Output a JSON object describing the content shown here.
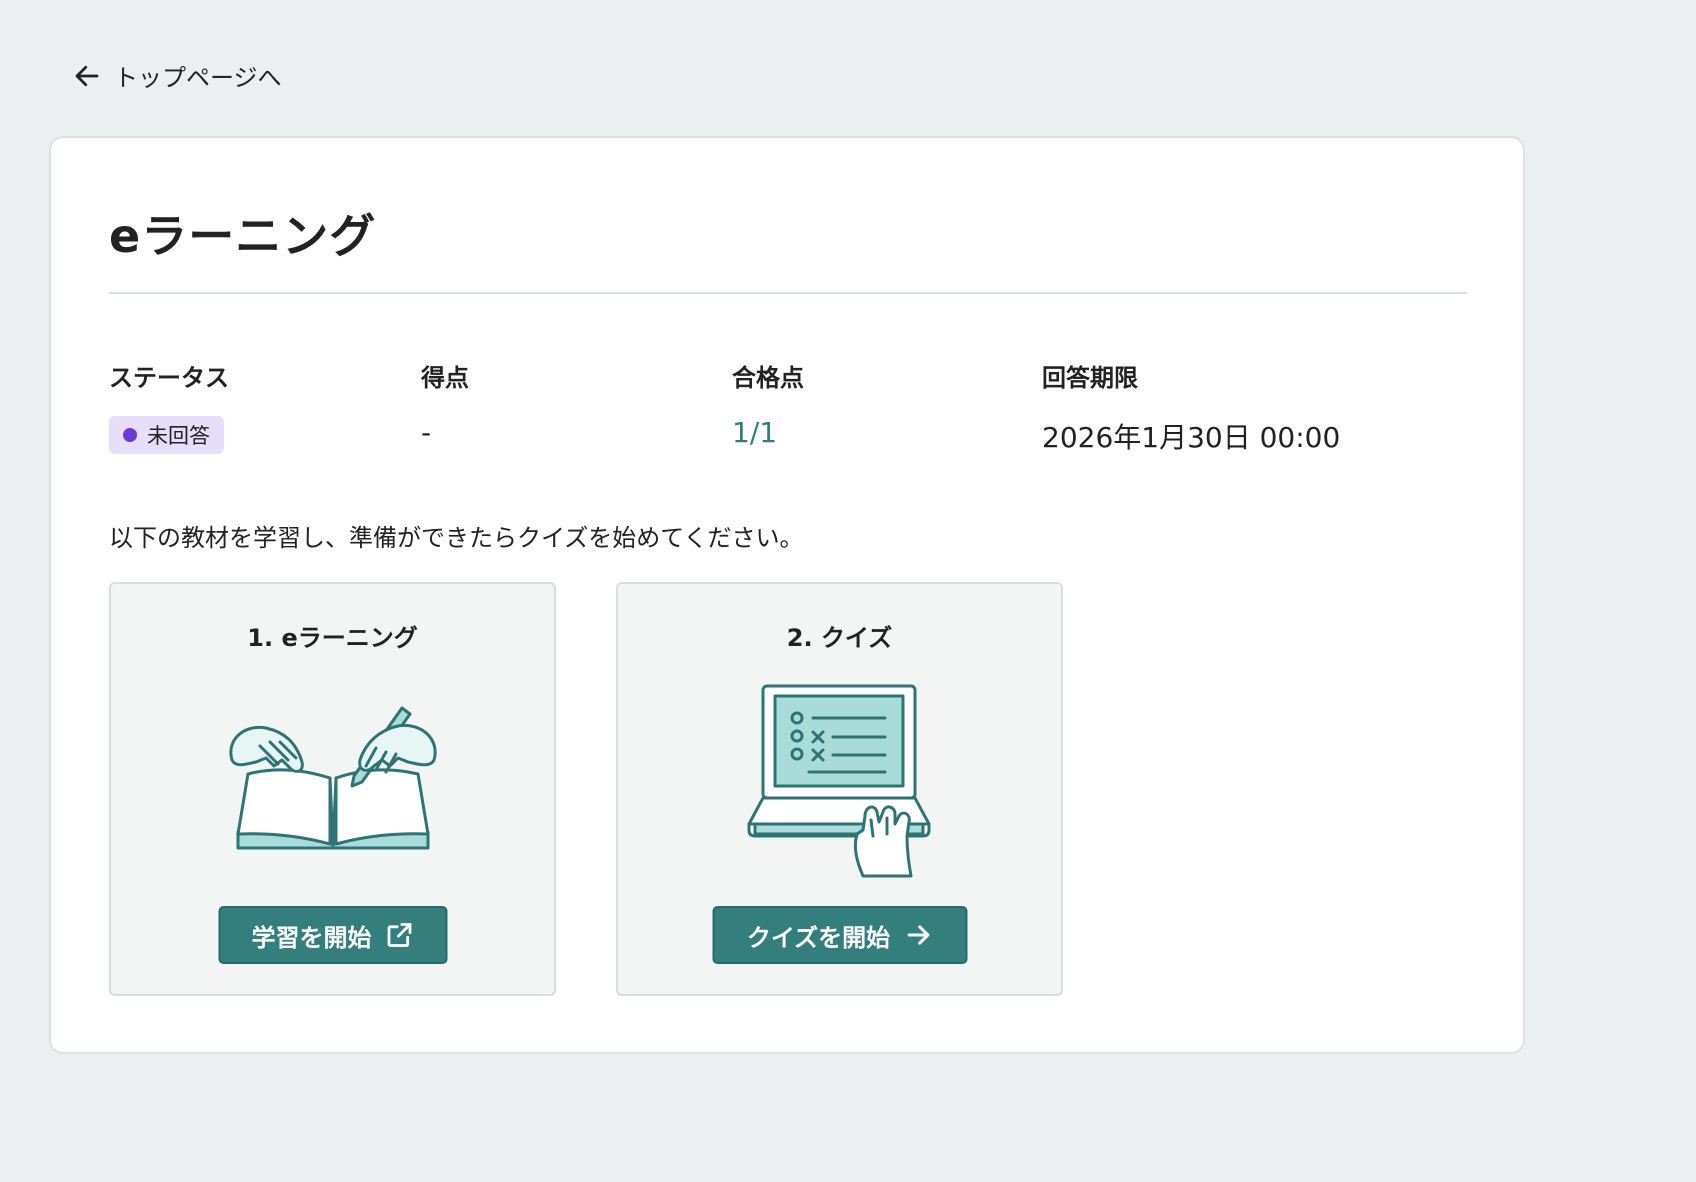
{
  "nav": {
    "back_label": "トップページへ"
  },
  "page": {
    "title": "eラーニング"
  },
  "info": {
    "status_label": "ステータス",
    "status_value": "未回答",
    "score_label": "得点",
    "score_value": "-",
    "passing_label": "合格点",
    "passing_value": "1/1",
    "deadline_label": "回答期限",
    "deadline_value": "2026年1月30日 00:00"
  },
  "instruction": "以下の教材を学習し、準備ができたらクイズを始めてください。",
  "steps": [
    {
      "title": "1. eラーニング",
      "button_label": "学習を開始",
      "button_icon": "external-link-icon",
      "illustration": "book-hands-illustration"
    },
    {
      "title": "2. クイズ",
      "button_label": "クイズを開始",
      "button_icon": "arrow-right-icon",
      "illustration": "laptop-quiz-illustration"
    }
  ],
  "colors": {
    "accent": "#347e7c",
    "badge_bg": "#e6defa",
    "badge_dot": "#6b3bd6",
    "page_bg": "#ecefef"
  }
}
